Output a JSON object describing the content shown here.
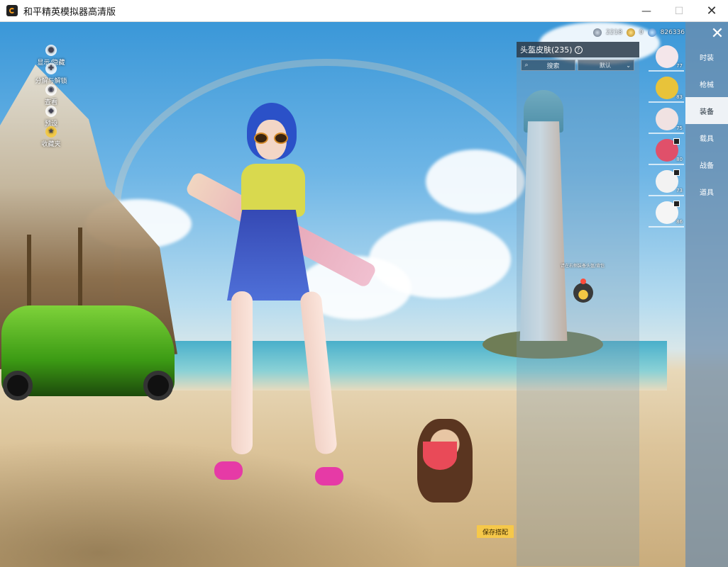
{
  "window": {
    "title": "和平精英模拟器高清版",
    "minimize": "—",
    "maximize": "☐",
    "close": "✕"
  },
  "currency": {
    "silver": "2218",
    "gold": "0",
    "blue": "826336"
  },
  "quick_actions": [
    {
      "label": "显示/隐藏",
      "icon": "user-icon"
    },
    {
      "label": "分解与解锁",
      "icon": "decompose-icon"
    },
    {
      "label": "查看",
      "icon": "eye-icon"
    },
    {
      "label": "预设",
      "icon": "preset-icon"
    },
    {
      "label": "收藏夹",
      "icon": "favorite-icon"
    }
  ],
  "panel": {
    "title": "头盔皮肤(235)",
    "help": "?",
    "search_label": "搜索",
    "sort_label": "默认",
    "hint": "请在右侧装备头盔/背包"
  },
  "thumbnails": [
    {
      "count": "77",
      "color": "#f4e6ea"
    },
    {
      "count": "83",
      "color": "#e8c33a"
    },
    {
      "count": "75",
      "color": "#f0e2e2"
    },
    {
      "count": "80",
      "color": "#e0506a"
    },
    {
      "count": "73",
      "color": "#f2f2f2"
    },
    {
      "count": "86",
      "color": "#f5f5f5"
    }
  ],
  "categories": [
    {
      "label": "时装",
      "active": false
    },
    {
      "label": "枪械",
      "active": false
    },
    {
      "label": "装备",
      "active": true
    },
    {
      "label": "载具",
      "active": false
    },
    {
      "label": "战备",
      "active": false
    },
    {
      "label": "道具",
      "active": false
    }
  ],
  "save_button": "保存搭配",
  "close_label": "✕"
}
